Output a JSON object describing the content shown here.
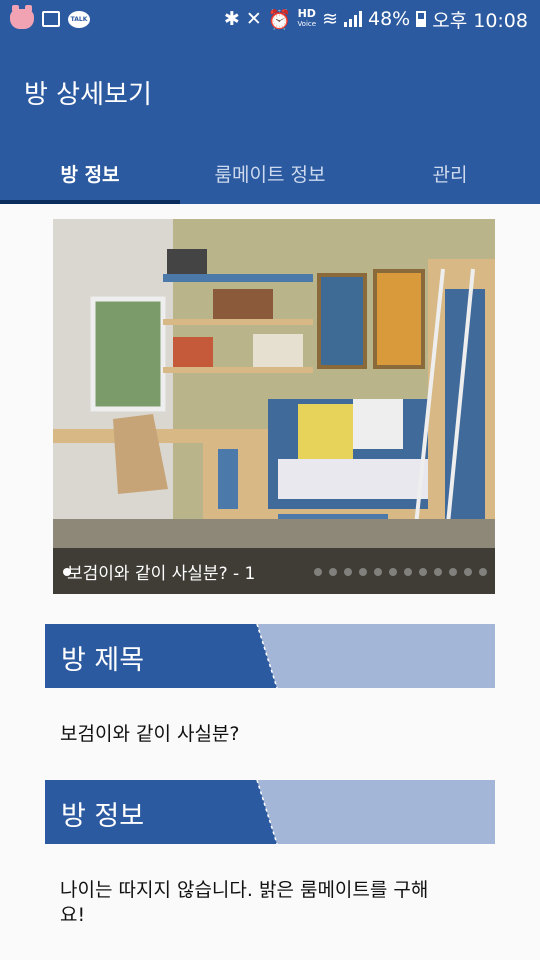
{
  "status_bar": {
    "battery": "48%",
    "time": "오후 10:08",
    "hd_label": "HD",
    "voice_label": "Voice",
    "talk_label": "TALK"
  },
  "app_bar": {
    "title": "방 상세보기"
  },
  "tabs": [
    {
      "label": "방 정보",
      "active": true
    },
    {
      "label": "룸메이트 정보",
      "active": false
    },
    {
      "label": "관리",
      "active": false
    }
  ],
  "photo": {
    "caption": "보검이와 같이 사실분? - 1"
  },
  "sections": [
    {
      "header": "방 제목",
      "text": "보검이와 같이 사실분?"
    },
    {
      "header": "방 정보",
      "text": "나이는 따지지 않습니다. 밝은 룸메이트를 구해요!"
    }
  ],
  "colors": {
    "primary": "#2c5aa0",
    "tab_indicator": "#0d2c5e",
    "section_light": "#a4b6d8"
  }
}
